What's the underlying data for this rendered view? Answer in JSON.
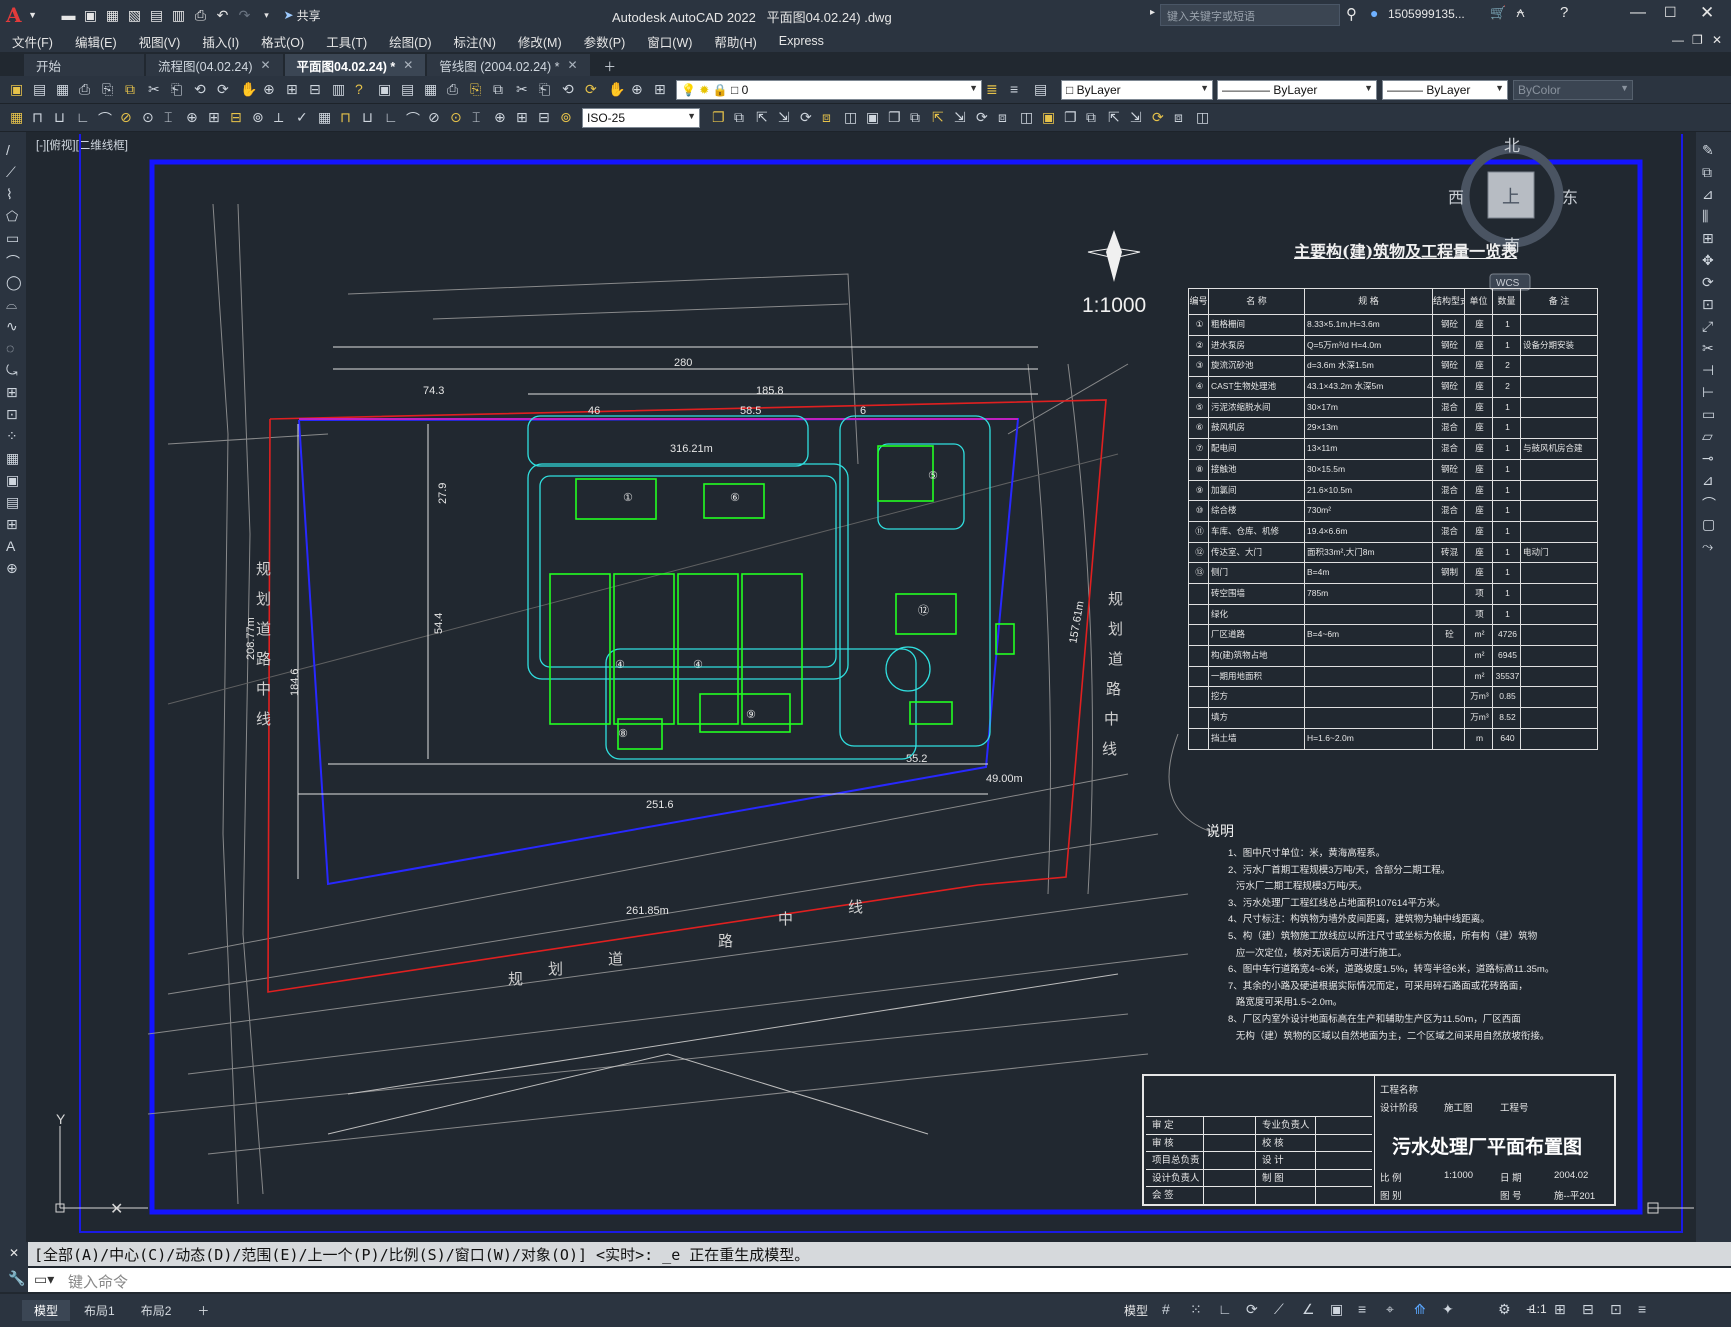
{
  "app": {
    "logo": "A",
    "title": "Autodesk AutoCAD 2022",
    "filename": "平面图04.02.24) .dwg",
    "search_placeholder": "键入关键字或短语",
    "user": "1505999135...",
    "share": "共享"
  },
  "menu": [
    "文件(F)",
    "编辑(E)",
    "视图(V)",
    "插入(I)",
    "格式(O)",
    "工具(T)",
    "绘图(D)",
    "标注(N)",
    "修改(M)",
    "参数(P)",
    "窗口(W)",
    "帮助(H)",
    "Express"
  ],
  "file_tabs": [
    {
      "label": "开始",
      "closable": false,
      "active": false
    },
    {
      "label": "流程图(04.02.24)",
      "closable": true,
      "active": false
    },
    {
      "label": "平面图04.02.24) *",
      "closable": true,
      "active": true
    },
    {
      "label": "管线图 (2004.02.24) *",
      "closable": true,
      "active": false
    }
  ],
  "toolbar": {
    "layer": "0",
    "color": "ByLayer",
    "linetype": "ByLayer",
    "lineweight": "ByLayer",
    "plotstyle": "ByColor",
    "dimstyle": "ISO-25"
  },
  "viewport_label": "[-][俯视][二维线框]",
  "viewcube": {
    "north": "北",
    "south": "南",
    "east": "东",
    "west": "西",
    "face": "上",
    "wcs": "WCS"
  },
  "drawing": {
    "scale": "1:1000",
    "table_title": "主要构(建)筑物及工程量一览表",
    "table_headers": [
      "编号",
      "名 称",
      "规 格",
      "结构型式",
      "单位",
      "数量",
      "备 注"
    ],
    "table_rows": [
      [
        "①",
        "粗格栅间",
        "8.33×5.1m,H=3.6m",
        "钢砼",
        "座",
        "1",
        ""
      ],
      [
        "②",
        "进水泵房",
        "Q=5万m³/d H=4.0m",
        "钢砼",
        "座",
        "1",
        "设备分期安装"
      ],
      [
        "③",
        "旋流沉砂池",
        "d=3.6m 水深1.5m",
        "钢砼",
        "座",
        "2",
        ""
      ],
      [
        "④",
        "CAST生物处理池",
        "43.1×43.2m 水深5m",
        "钢砼",
        "座",
        "2",
        ""
      ],
      [
        "⑤",
        "污泥浓缩脱水间",
        "30×17m",
        "混合",
        "座",
        "1",
        ""
      ],
      [
        "⑥",
        "鼓风机房",
        "29×13m",
        "混合",
        "座",
        "1",
        ""
      ],
      [
        "⑦",
        "配电间",
        "13×11m",
        "混合",
        "座",
        "1",
        "与鼓风机房合建"
      ],
      [
        "⑧",
        "接触池",
        "30×15.5m",
        "钢砼",
        "座",
        "1",
        ""
      ],
      [
        "⑨",
        "加氯间",
        "21.6×10.5m",
        "混合",
        "座",
        "1",
        ""
      ],
      [
        "⑩",
        "综合楼",
        "730m²",
        "混合",
        "座",
        "1",
        ""
      ],
      [
        "⑪",
        "车库、仓库、机修",
        "19.4×6.6m",
        "混合",
        "座",
        "1",
        ""
      ],
      [
        "⑫",
        "传达室、大门",
        "面积33m²,大门8m",
        "砖混",
        "座",
        "1",
        "电动门"
      ],
      [
        "⑬",
        "侧门",
        "B=4m",
        "钢制",
        "座",
        "1",
        ""
      ],
      [
        "",
        "砖空围墙",
        "785m",
        "",
        "项",
        "1",
        ""
      ],
      [
        "",
        "绿化",
        "",
        "",
        "项",
        "1",
        ""
      ],
      [
        "",
        "厂区道路",
        "B=4~6m",
        "砼",
        "m²",
        "4726",
        ""
      ],
      [
        "",
        "构(建)筑物占地",
        "",
        "",
        "m²",
        "6945",
        ""
      ],
      [
        "",
        "一期用地面积",
        "",
        "",
        "m²",
        "35537",
        ""
      ],
      [
        "",
        "挖方",
        "",
        "",
        "万m³",
        "0.85",
        ""
      ],
      [
        "",
        "填方",
        "",
        "",
        "万m³",
        "8.52",
        ""
      ],
      [
        "",
        "挡土墙",
        "H=1.6~2.0m",
        "",
        "m",
        "640",
        ""
      ]
    ],
    "notes_title": "说明",
    "notes": [
      "1、图中尺寸单位：米，黄海高程系。",
      "2、污水厂首期工程规模3万吨/天，含部分二期工程。",
      "   污水厂二期工程规模3万吨/天。",
      "3、污水处理厂工程红线总占地面积107614平方米。",
      "4、尺寸标注：构筑物为墙外皮间距离，建筑物为轴中线距离。",
      "5、构（建）筑物施工放线应以所注尺寸或坐标为依据，所有构（建）筑物",
      "   应一次定位，核对无误后方可进行施工。",
      "6、图中车行道路宽4~6米，道路坡度1.5%，转弯半径6米，道路标高11.35m。",
      "7、其余的小路及硬道根据实际情况而定，可采用碎石路面或花砖路面，",
      "   路宽度可采用1.5~2.0m。",
      "8、厂区内室外设计地面标高在生产和辅助生产区为11.50m，厂区西面",
      "   无构（建）筑物的区域以自然地面为主，二个区域之间采用自然放坡衔接。"
    ],
    "titleblock": {
      "project_name_label": "工程名称",
      "stage_label": "设计阶段",
      "stage": "施工图",
      "project_no_label": "工程号",
      "drawing_title": "污水处理厂平面布置图",
      "rows_left": [
        "审 定",
        "审 核",
        "项目总负责",
        "设计负责人",
        "会 签"
      ],
      "rows_mid": [
        "专业负责人",
        "校 核",
        "设 计",
        "制 图",
        ""
      ],
      "scale_label": "比 例",
      "scale": "1:1000",
      "date_label": "日 期",
      "date": "2004.02",
      "sheet_label": "图 别",
      "sheet_no_label": "图 号",
      "sheet_no": "施--平201"
    },
    "dims": [
      "280",
      "74.3",
      "185.8",
      "46",
      "58.5",
      "6",
      "316.21m",
      "251.6",
      "55.2",
      "49.00m",
      "261.85m",
      "208.77m",
      "157.61m",
      "184.6",
      "54.4",
      "27.9"
    ],
    "road_labels": [
      "规",
      "划",
      "道",
      "路",
      "中",
      "线"
    ]
  },
  "command": {
    "history": "[全部(A)/中心(C)/动态(D)/范围(E)/上一个(P)/比例(S)/窗口(W)/对象(O)] <实时>: _e 正在重生成模型。",
    "placeholder": "键入命令"
  },
  "layout_tabs": [
    "模型",
    "布局1",
    "布局2"
  ],
  "status": {
    "model": "模型",
    "scale": "1:1"
  }
}
